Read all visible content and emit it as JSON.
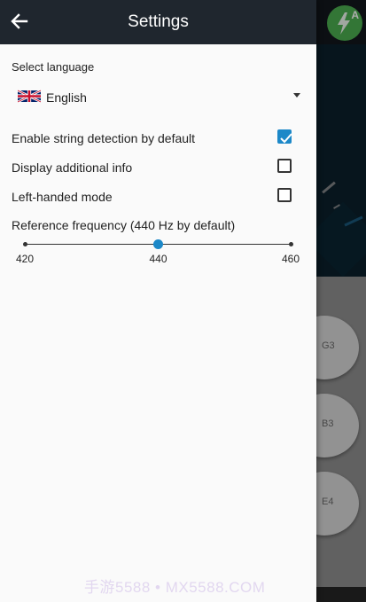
{
  "header": {
    "title": "Settings"
  },
  "language": {
    "section_label": "Select language",
    "selected": "English",
    "flag_icon": "uk-flag-icon"
  },
  "options": [
    {
      "label": "Enable string detection by default",
      "checked": true
    },
    {
      "label": "Display additional info",
      "checked": false
    },
    {
      "label": "Left-handed mode",
      "checked": false
    }
  ],
  "reference_frequency": {
    "label": "Reference frequency (440 Hz by default)",
    "min": 420,
    "max": 460,
    "value": 440,
    "min_label": "420",
    "value_label": "440",
    "max_label": "460"
  },
  "background": {
    "auto_mode_label": "A",
    "strings": [
      "G3",
      "B3",
      "E4"
    ]
  },
  "watermark": "手游5588 • MX5588.COM",
  "colors": {
    "accent": "#1c88c8",
    "header": "#1f262e",
    "auto_button": "#4caf50"
  }
}
